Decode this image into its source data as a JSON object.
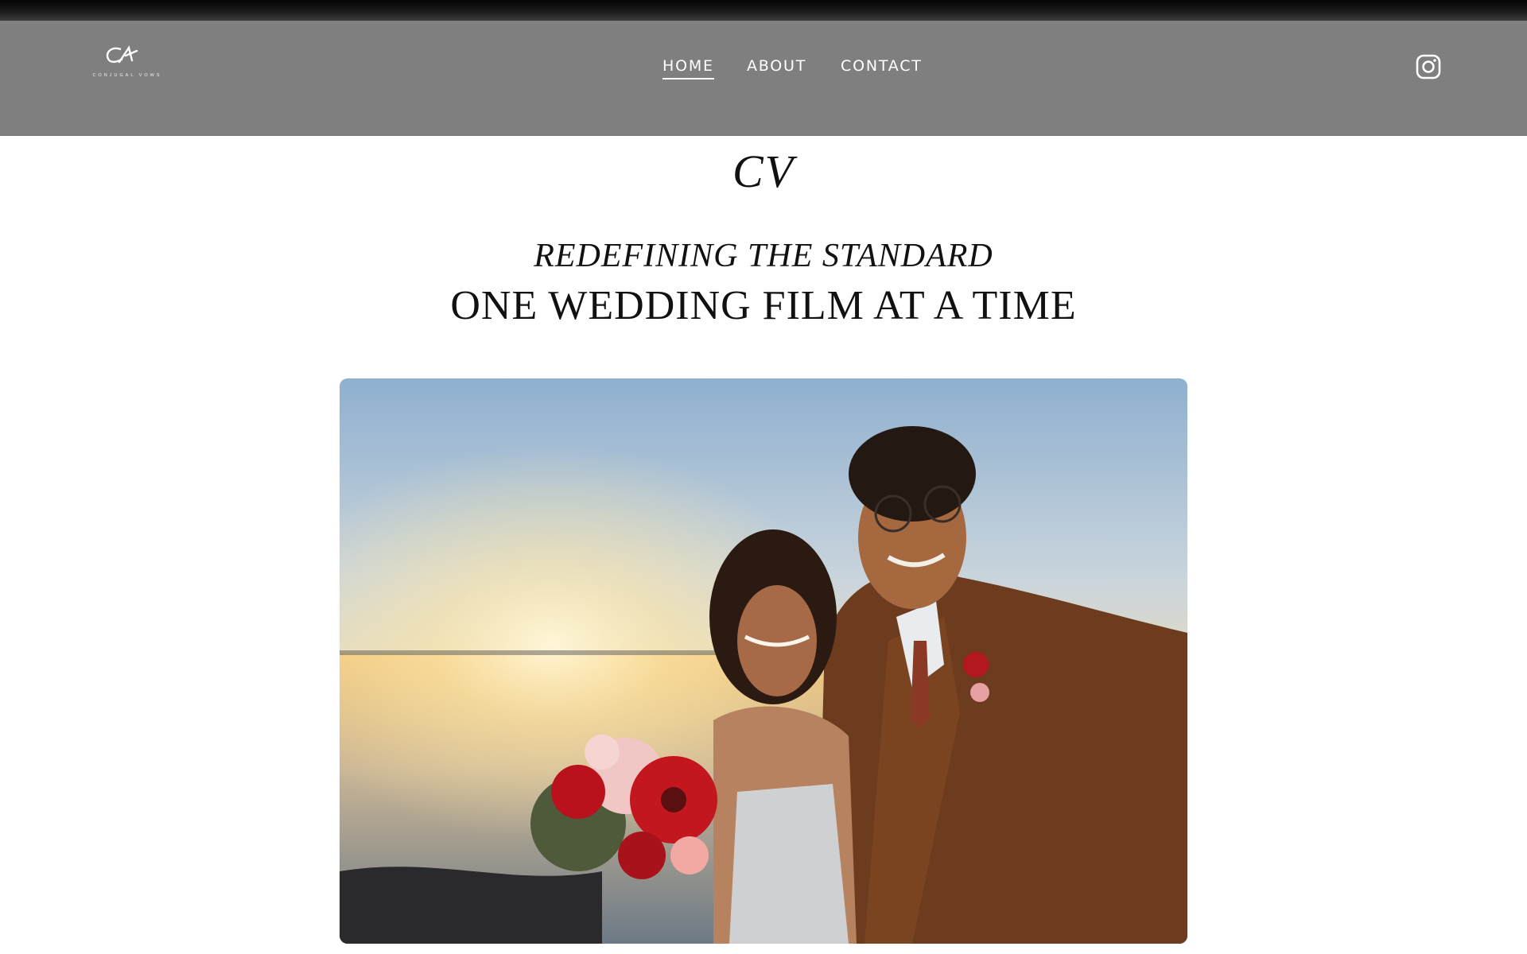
{
  "header": {
    "logo_text": "CV",
    "logo_subtext": "CONJUGAL VOWS",
    "nav": [
      {
        "label": "HOME",
        "active": true
      },
      {
        "label": "ABOUT",
        "active": false
      },
      {
        "label": "CONTACT",
        "active": false
      }
    ],
    "social_icon": "instagram-icon"
  },
  "hero_text": {
    "monogram": "CV",
    "line1": "REDEFINING THE STANDARD",
    "line2": "ONE WEDDING FILM AT A TIME"
  },
  "hero_image": {
    "subject": "Bride and groom taking a selfie at a lakeside sunset"
  },
  "colors": {
    "header_bg": "#7f7f7f",
    "text": "#111111",
    "nav_text": "#ffffff"
  }
}
